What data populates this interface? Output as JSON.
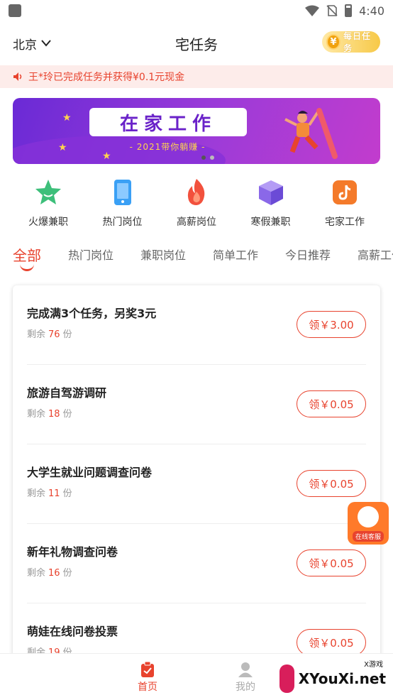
{
  "status_bar": {
    "time": "4:40"
  },
  "header": {
    "city": "北京",
    "title": "宅任务",
    "sign_label": "每日任务",
    "sign_coin": "¥"
  },
  "notice": {
    "text": "王*玲已完成任务并获得¥0.1元现金"
  },
  "banner": {
    "title": "在家工作",
    "subtitle": "- 2021带你躺赚 -"
  },
  "categories": [
    {
      "label": "火爆兼职",
      "icon": "star-icon",
      "color": "#3dbf7a"
    },
    {
      "label": "热门岗位",
      "icon": "phone-icon",
      "color": "#3aa0f5"
    },
    {
      "label": "高薪岗位",
      "icon": "flame-icon",
      "color": "#f2513d"
    },
    {
      "label": "寒假兼职",
      "icon": "cube-icon",
      "color": "#8a68e8"
    },
    {
      "label": "宅家工作",
      "icon": "tiktok-icon",
      "color": "#f47a2a"
    }
  ],
  "tabs": [
    {
      "label": "全部",
      "active": true
    },
    {
      "label": "热门岗位"
    },
    {
      "label": "兼职岗位"
    },
    {
      "label": "简单工作"
    },
    {
      "label": "今日推荐"
    },
    {
      "label": "高薪工作"
    }
  ],
  "tasks": [
    {
      "title": "完成满3个任务，另奖3元",
      "remain_prefix": "剩余",
      "remain": "76",
      "remain_suffix": "份",
      "button": "领￥3.00"
    },
    {
      "title": "旅游自驾游调研",
      "remain_prefix": "剩余",
      "remain": "18",
      "remain_suffix": "份",
      "button": "领￥0.05"
    },
    {
      "title": "大学生就业问题调查问卷",
      "remain_prefix": "剩余",
      "remain": "11",
      "remain_suffix": "份",
      "button": "领￥0.05"
    },
    {
      "title": "新年礼物调查问卷",
      "remain_prefix": "剩余",
      "remain": "16",
      "remain_suffix": "份",
      "button": "领￥0.05"
    },
    {
      "title": "萌娃在线问卷投票",
      "remain_prefix": "剩余",
      "remain": "19",
      "remain_suffix": "份",
      "button": "领￥0.05"
    }
  ],
  "service": {
    "label": "在线客服"
  },
  "bottom_nav": {
    "home": "首页",
    "mine": "我的"
  },
  "watermark": {
    "text": "XYouXi.net",
    "small": "X游戏"
  },
  "colors": {
    "accent": "#e8432e",
    "notice_bg": "#fdecea"
  }
}
